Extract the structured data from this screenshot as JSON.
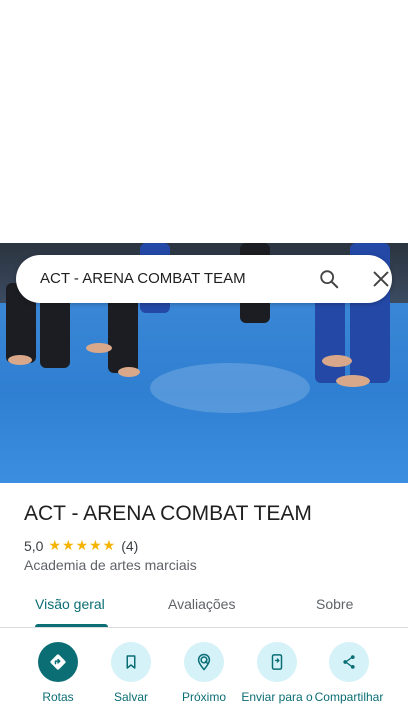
{
  "search": {
    "query": "ACT - ARENA COMBAT TEAM"
  },
  "place": {
    "name": "ACT - ARENA COMBAT TEAM",
    "rating": "5,0",
    "stars": "★★★★★",
    "review_count": "(4)",
    "category": "Academia de artes marciais"
  },
  "tabs": [
    {
      "label": "Visão geral",
      "active": true
    },
    {
      "label": "Avaliações",
      "active": false
    },
    {
      "label": "Sobre",
      "active": false
    }
  ],
  "actions": [
    {
      "label": "Rotas",
      "icon": "directions-icon"
    },
    {
      "label": "Salvar",
      "icon": "bookmark-icon"
    },
    {
      "label": "Próximo",
      "icon": "nearby-icon"
    },
    {
      "label": "Enviar para o",
      "icon": "send-to-phone-icon"
    },
    {
      "label": "Compartilhar",
      "icon": "share-icon"
    }
  ],
  "colors": {
    "accent": "#0b6e74",
    "action_bg": "#d4f2f8",
    "star": "#f4b400"
  }
}
